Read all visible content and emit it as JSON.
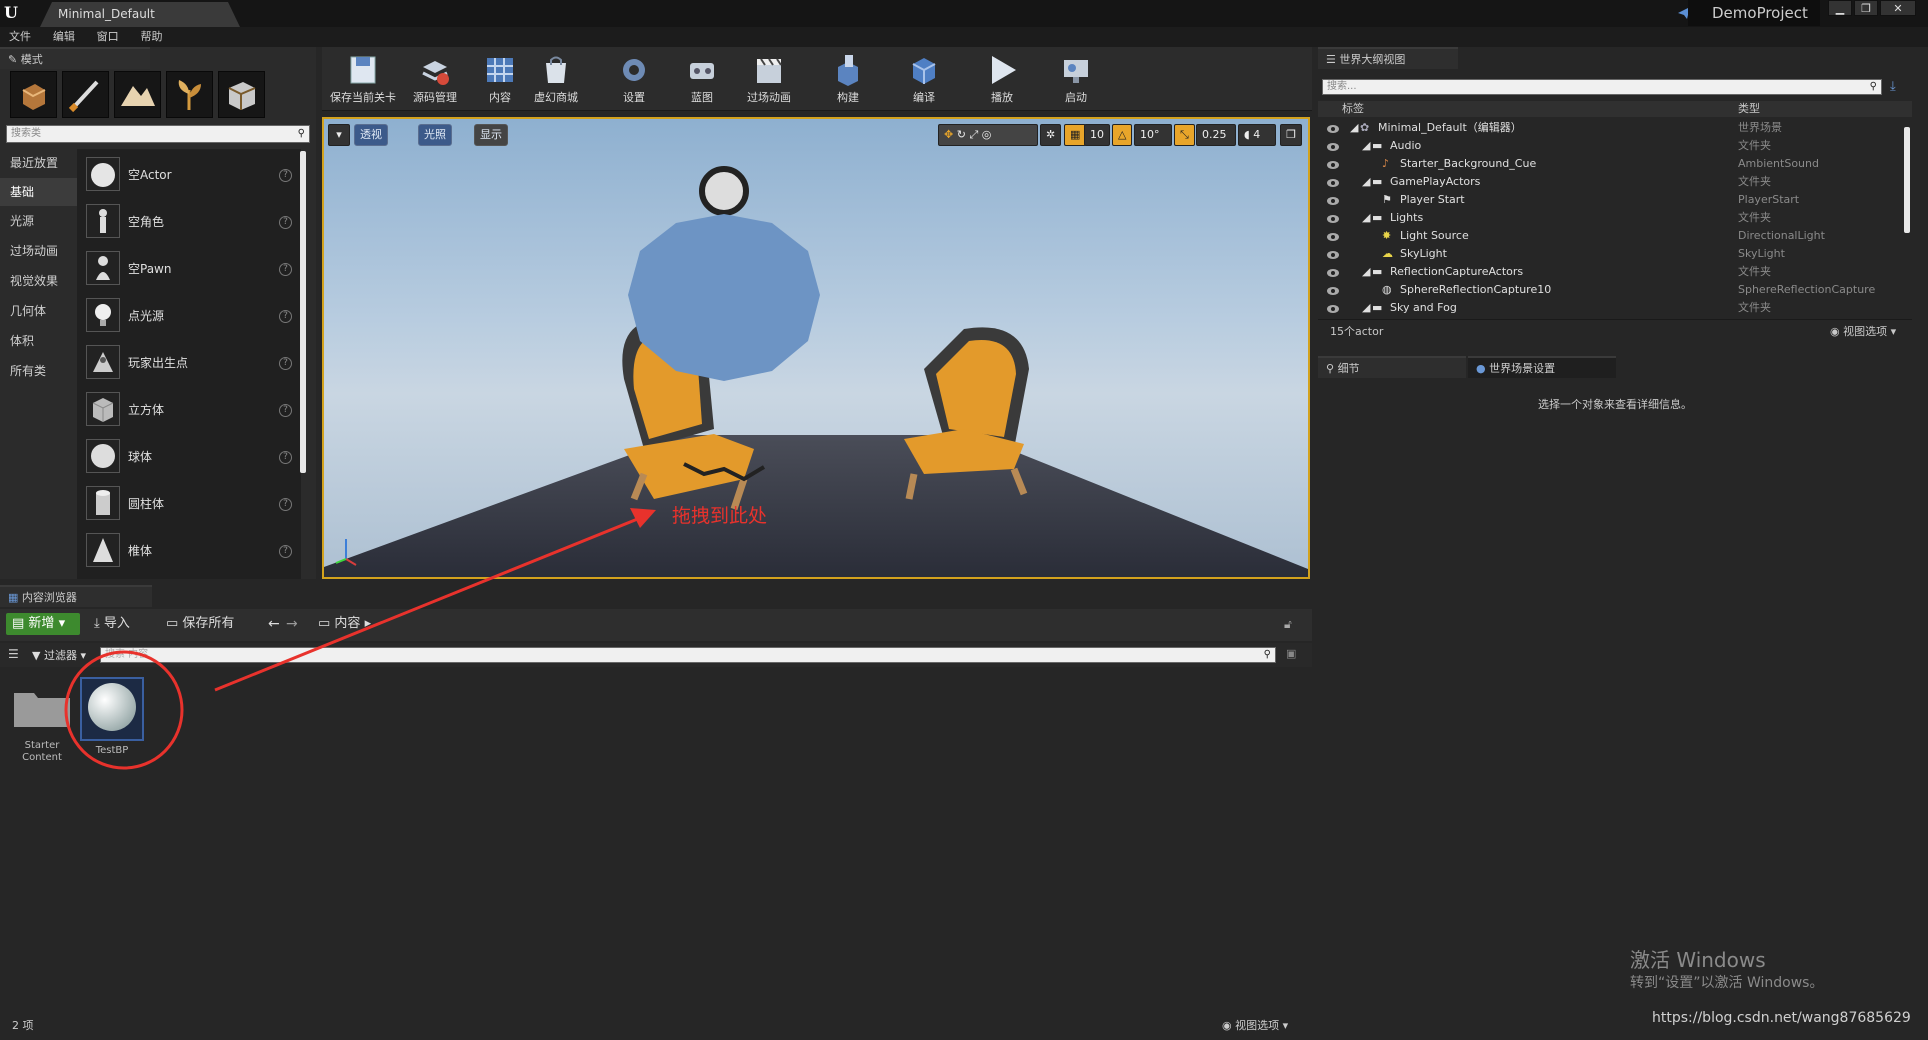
{
  "app": {
    "doc_tab": "Minimal_Default",
    "project_name": "DemoProject",
    "win_min": "▁",
    "win_max": "❐",
    "win_close": "✕",
    "menu": [
      "文件",
      "编辑",
      "窗口",
      "帮助"
    ]
  },
  "modes": {
    "tab_label": "模式",
    "search_placeholder": "搜索类",
    "categories": [
      "最近放置",
      "基础",
      "光源",
      "过场动画",
      "视觉效果",
      "几何体",
      "体积",
      "所有类"
    ],
    "selected_category": "基础",
    "items": [
      "空Actor",
      "空角色",
      "空Pawn",
      "点光源",
      "玩家出生点",
      "立方体",
      "球体",
      "圆柱体",
      "椎体"
    ],
    "help_glyph": "?"
  },
  "toolbar": {
    "buttons": [
      "保存当前关卡",
      "源码管理",
      "内容",
      "虚幻商城",
      "设置",
      "蓝图",
      "过场动画",
      "构建",
      "编译",
      "播放",
      "启动"
    ]
  },
  "viewport": {
    "perspective": "透视",
    "lit": "光照",
    "show": "显示",
    "grid_snap": "10",
    "rot_snap": "10°",
    "scale_snap": "0.25",
    "camera_speed": "4",
    "annotation": "拖拽到此处"
  },
  "outliner": {
    "tab_label": "世界大纲视图",
    "search_placeholder": "搜索...",
    "col_label": "标签",
    "col_type": "类型",
    "rows": [
      {
        "label": "Minimal_Default（编辑器）",
        "type": "世界场景"
      },
      {
        "label": "Audio",
        "type": "文件夹"
      },
      {
        "label": "Starter_Background_Cue",
        "type": "AmbientSound"
      },
      {
        "label": "GamePlayActors",
        "type": "文件夹"
      },
      {
        "label": "Player Start",
        "type": "PlayerStart"
      },
      {
        "label": "Lights",
        "type": "文件夹"
      },
      {
        "label": "Light Source",
        "type": "DirectionalLight"
      },
      {
        "label": "SkyLight",
        "type": "SkyLight"
      },
      {
        "label": "ReflectionCaptureActors",
        "type": "文件夹"
      },
      {
        "label": "SphereReflectionCapture10",
        "type": "SphereReflectionCapture"
      },
      {
        "label": "Sky and Fog",
        "type": "文件夹"
      }
    ],
    "count": "15个actor",
    "view_options": "视图选项"
  },
  "details": {
    "tab_details": "细节",
    "tab_world": "世界场景设置",
    "empty_text": "选择一个对象来查看详细信息。"
  },
  "content_browser": {
    "tab_label": "内容浏览器",
    "add_new": "新增",
    "import": "导入",
    "save_all": "保存所有",
    "path_root": "内容",
    "filters": "过滤器",
    "search_placeholder": "搜索 内容",
    "assets": [
      {
        "name": "Starter Content"
      },
      {
        "name": "TestBP"
      }
    ],
    "item_count": "2 项",
    "view_options": "视图选项"
  },
  "watermark": {
    "line1": "激活 Windows",
    "line2": "转到“设置”以激活 Windows。",
    "url": "https://blog.csdn.net/wang87685629"
  }
}
